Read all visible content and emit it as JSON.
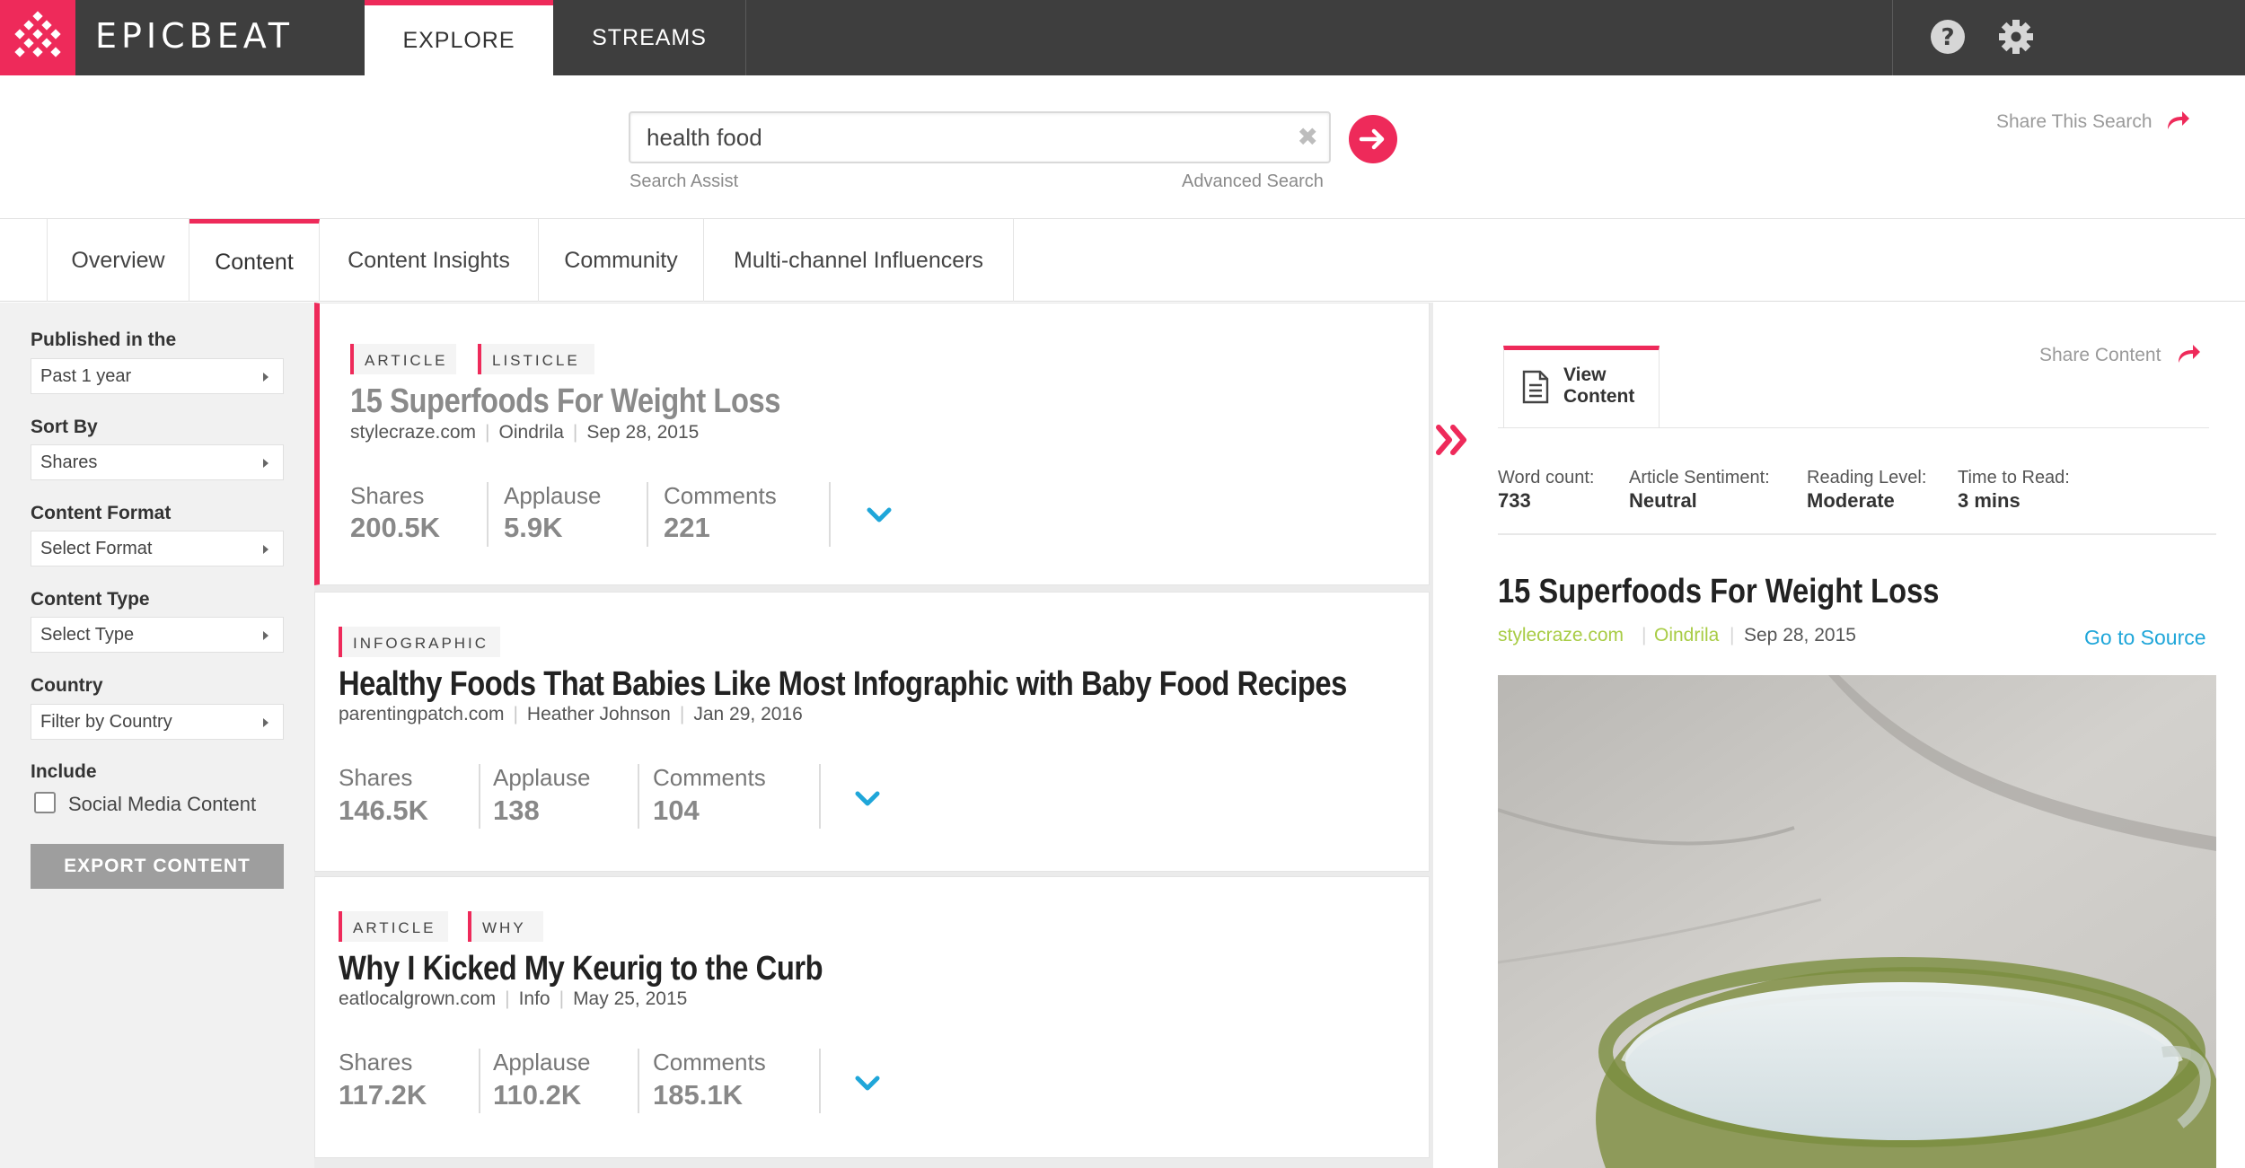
{
  "app": {
    "logo_text": "EPICBEAT"
  },
  "nav": {
    "tabs": [
      {
        "label": "EXPLORE",
        "active": true
      },
      {
        "label": "STREAMS",
        "active": false
      }
    ],
    "icons": [
      "help-icon",
      "gear-icon"
    ]
  },
  "search": {
    "value": "health food",
    "assist_label": "Search Assist",
    "advanced_label": "Advanced Search",
    "share_label": "Share This Search"
  },
  "subtabs": [
    {
      "label": "Overview",
      "active": false
    },
    {
      "label": "Content",
      "active": true
    },
    {
      "label": "Content Insights",
      "active": false
    },
    {
      "label": "Community",
      "active": false
    },
    {
      "label": "Multi-channel Influencers",
      "active": false
    }
  ],
  "filters": {
    "published": {
      "label": "Published in the",
      "value": "Past 1 year"
    },
    "sort": {
      "label": "Sort By",
      "value": "Shares"
    },
    "format": {
      "label": "Content Format",
      "value": "Select Format"
    },
    "type": {
      "label": "Content Type",
      "value": "Select Type"
    },
    "country": {
      "label": "Country",
      "value": "Filter by Country"
    },
    "include": {
      "label": "Include",
      "checkbox_label": "Social Media Content",
      "checked": false
    },
    "export_label": "EXPORT CONTENT"
  },
  "cards": [
    {
      "tags": [
        "ARTICLE",
        "LISTICLE"
      ],
      "title": "15 Superfoods For Weight Loss",
      "domain": "stylecraze.com",
      "author": "Oindrila",
      "date": "Sep 28, 2015",
      "stats": [
        {
          "label": "Shares",
          "value": "200.5K"
        },
        {
          "label": "Applause",
          "value": "5.9K"
        },
        {
          "label": "Comments",
          "value": "221"
        }
      ]
    },
    {
      "tags": [
        "INFOGRAPHIC"
      ],
      "title": "Healthy Foods That Babies Like Most Infographic with Baby Food Recipes",
      "domain": "parentingpatch.com",
      "author": "Heather Johnson",
      "date": "Jan 29, 2016",
      "stats": [
        {
          "label": "Shares",
          "value": "146.5K"
        },
        {
          "label": "Applause",
          "value": "138"
        },
        {
          "label": "Comments",
          "value": "104"
        }
      ]
    },
    {
      "tags": [
        "ARTICLE",
        "WHY"
      ],
      "title": "Why I Kicked My Keurig to the Curb",
      "domain": "eatlocalgrown.com",
      "author": "Info",
      "date": "May 25, 2015",
      "stats": [
        {
          "label": "Shares",
          "value": "117.2K"
        },
        {
          "label": "Applause",
          "value": "110.2K"
        },
        {
          "label": "Comments",
          "value": "185.1K"
        }
      ]
    }
  ],
  "detail": {
    "tab_label": "View Content",
    "share_label": "Share Content",
    "metrics": [
      {
        "label": "Word count:",
        "value": "733"
      },
      {
        "label": "Article Sentiment:",
        "value": "Neutral"
      },
      {
        "label": "Reading Level:",
        "value": "Moderate"
      },
      {
        "label": "Time to Read:",
        "value": "3 mins"
      }
    ],
    "title": "15 Superfoods For Weight Loss",
    "domain": "stylecraze.com",
    "author": "Oindrila",
    "date": "Sep 28, 2015",
    "source_link": "Go to Source"
  },
  "colors": {
    "accent": "#ee2a5a",
    "link": "#1fa6d9",
    "green": "#a8cc45",
    "topbar": "#3e3e3e"
  }
}
